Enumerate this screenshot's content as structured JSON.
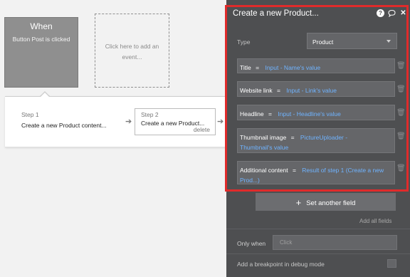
{
  "trigger": {
    "title": "When",
    "event": "Button Post is clicked",
    "add_event_line1": "Click here to add an",
    "add_event_line2": "event..."
  },
  "steps": [
    {
      "number": "Step 1",
      "name": "Create a new Product content..."
    },
    {
      "number": "Step 2",
      "name": "Create a new Product...",
      "delete_label": "delete"
    }
  ],
  "panel": {
    "title": "Create a new Product...",
    "icons": [
      "help-icon",
      "comment-icon",
      "close-icon"
    ],
    "type_label": "Type",
    "type_value": "Product",
    "fields": [
      {
        "label": "Title",
        "eq": "=",
        "value": "Input - Name's value"
      },
      {
        "label": "Website link",
        "eq": "=",
        "value": "Input - Link's value"
      },
      {
        "label": "Headline",
        "eq": "=",
        "value": "Input - Headline's value"
      },
      {
        "label": "Thumbnail image",
        "eq": "=",
        "value_line1": "PictureUploader -",
        "value_line2": "Thumbnail's value"
      },
      {
        "label": "Additional content",
        "eq": "=",
        "value_line1": "Result of step 1 (Create a new",
        "value_line2": "Prod...)"
      }
    ],
    "set_field_label": "Set another field",
    "add_all_label": "Add all fields",
    "only_when_label": "Only when",
    "only_when_placeholder": "Click",
    "debug_label": "Add a breakpoint in debug mode"
  },
  "colors": {
    "highlight_frame": "#e02b2b",
    "panel_bg": "#4e4f51",
    "dynamic_value": "#6fb3ff"
  }
}
